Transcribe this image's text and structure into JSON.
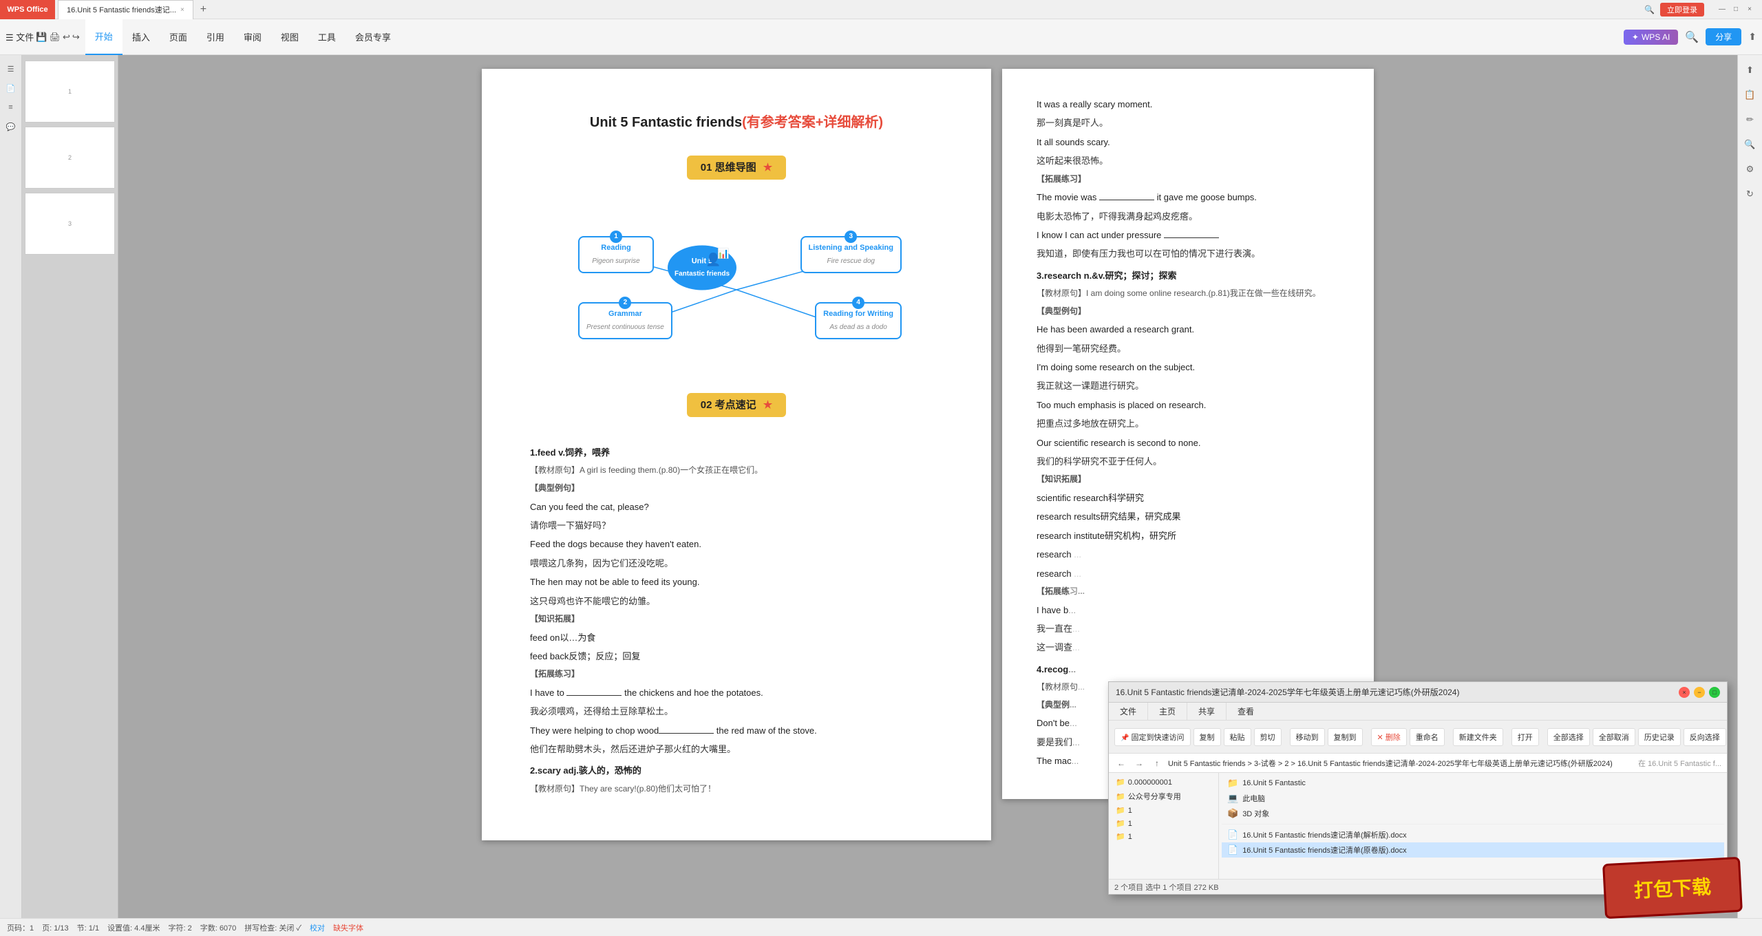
{
  "titlebar": {
    "logo": "WPS Office",
    "tab_name": "16.Unit 5 Fantastic friends速记...",
    "tab_close": "×",
    "tab_add": "+",
    "register_btn": "立即登录",
    "win_min": "—",
    "win_max": "□",
    "win_close": "×"
  },
  "ribbon": {
    "quick_items": [
      "文件",
      "▼"
    ],
    "tabs": [
      "开始",
      "插入",
      "页面",
      "引用",
      "审阅",
      "视图",
      "工具",
      "会员专享"
    ],
    "active_tab": "开始",
    "wps_ai": "WPS AI",
    "search_icon": "🔍",
    "share_btn": "分享"
  },
  "status_bar": {
    "page": "页码：1",
    "total_pages": "页: 1/13",
    "section": "节: 1/1",
    "settings": "设置值: 4.4厘米",
    "column": "字符: 2",
    "word_count": "字数: 6070",
    "spell_check": "拼写检查: 关闭 ✓",
    "proofread": "校对",
    "missing_font": "缺失字体"
  },
  "doc_left": {
    "title_black": "Unit 5 Fantastic friends",
    "title_red": "(有参考答案+详细解析)",
    "section1_label": "01  思维导图",
    "star": "★",
    "mind_center_line1": "Unit 5",
    "mind_center_line2": "Fantastic friends",
    "node1_num": "1",
    "node1_title": "Reading",
    "node1_subtitle": "Pigeon surprise",
    "node2_num": "2",
    "node2_title": "Grammar",
    "node2_subtitle": "Present continuous tense",
    "node3_num": "3",
    "node3_title": "Listening and Speaking",
    "node3_subtitle": "Fire rescue dog",
    "node4_num": "4",
    "node4_title": "Reading for Writing",
    "node4_subtitle": "As dead as a dodo",
    "section2_label": "02  考点速记",
    "star2": "★",
    "items": [
      {
        "id": "1",
        "en_word": "1.feed v.饲养，喂养",
        "note1": "【教材原句】A girl is feeding them.(p.80)一个女孩正在喂它们。",
        "note2": "【典型例句】",
        "examples": [
          {
            "en": "Can you feed the cat, please?",
            "cn": "请你喂一下猫好吗？"
          },
          {
            "en": "Feed the dogs because they haven't eaten.",
            "cn": "喂喂这几条狗，因为它们还没吃呢。"
          },
          {
            "en": "The hen may not be able to feed its young.",
            "cn": "这只母鸡也许不能喂它的幼雏。"
          }
        ],
        "expand": "【知识拓展】",
        "expand_items": [
          "feed on以…为食",
          "feed back反馈；反应；回复"
        ],
        "practice": "【拓展练习】",
        "practice_en": "I have to __________ the chickens and hoe the potatoes.",
        "practice_cn": "我必须喂鸡，还得给土豆除草松土。",
        "practice2_en": "They were helping to chop wood__________ the red maw of the stove.",
        "practice2_cn": "他们在帮助劈木头，然后还进炉子那火红的大嘴里。"
      },
      {
        "id": "2",
        "word": "2.scary adj.骇人的，恐怖的",
        "note1": "【教材原句】They are scary!(p.80)他们太可怕了！"
      }
    ]
  },
  "doc_right": {
    "lines": [
      {
        "en": "It was a really scary moment.",
        "cn": "那一刻真是吓人。"
      },
      {
        "en": "It all sounds scary.",
        "cn": "这听起来很恐怖。"
      },
      {
        "bracket": "【拓展练习】"
      },
      {
        "en": "The movie was __________ it gave me goose bumps.",
        "cn": "电影太恐怖了，吓得我满身起鸡皮疙瘩。"
      },
      {
        "en": "I know I can act under pressure __________",
        "cn": "我知道，即使有压力我也可以在可怕的情况下进行表演。"
      },
      {
        "word": "3.research n.&v.研究；探讨；探索"
      },
      {
        "bracket": "【教材原句】I am doing some online research.(p.81)我正在做一些在线研究。"
      },
      {
        "bracket": "【典型例句】"
      },
      {
        "en": "He has been awarded a research grant.",
        "cn": "他得到一笔研究经费。"
      },
      {
        "en": "I'm doing some research on the subject.",
        "cn": "我正就这一课题进行研究。"
      },
      {
        "en": "Too much emphasis is placed on research.",
        "cn": "把重点过多地放在研究上。"
      },
      {
        "en": "Our scientific research is second to none.",
        "cn": "我们的科学研究不亚于任何人。"
      },
      {
        "bracket": "【知识拓展】"
      },
      {
        "item": "scientific research科学研究"
      },
      {
        "item": "research results研究结果，研究成果"
      },
      {
        "item": "research institute研究机构，研究所"
      },
      {
        "item": "research..."
      },
      {
        "item": "research..."
      },
      {
        "bracket2": "【拓展练习..."
      },
      {
        "en2": "I have b...",
        "cn2": "我一直在..."
      },
      {
        "cn3": "这一调查..."
      },
      {
        "word2": "4.recog..."
      },
      {
        "bracket3": "【教材原句..."
      },
      {
        "bracket4": "【典型例..."
      },
      {
        "en3": "Don't be...",
        "cn4": "要是我们..."
      },
      {
        "en4": "The mac...",
        "cn5": ""
      }
    ]
  },
  "file_manager": {
    "title": "16.Unit 5 Fantastic friends速记清单-2024-2025学年七年级英语上册单元速记巧练(外研版2024)",
    "toolbar_buttons": [
      "固定到快速访问",
      "复制",
      "粘贴",
      "剪切",
      "移动到",
      "复制到",
      "删除",
      "重命名",
      "新建文件夹",
      "打开",
      "全部选择",
      "全部取消",
      "历史记录",
      "反向选择"
    ],
    "nav_path": "< > ↑  Unit 5 Fantastic friends > 3-试卷 > 2 > 16.Unit 5 Fantastic friends速记清单-2024-2025学年七年级英语上册单元速记巧练(外研版2024)",
    "nav_search": "在 16.Unit 5 Fantastic f...",
    "left_items": [
      {
        "name": "0.000000001",
        "type": "folder"
      },
      {
        "name": "公众号分享专用",
        "type": "folder"
      },
      {
        "name": "1",
        "type": "folder"
      },
      {
        "name": "1",
        "type": "folder"
      },
      {
        "name": "1",
        "type": "folder"
      }
    ],
    "right_files": [
      {
        "name": "16.Unit 5 Fantastic",
        "type": "folder"
      },
      {
        "name": "此电脑",
        "type": "system"
      },
      {
        "name": "3D 对象",
        "type": "folder"
      },
      {
        "name": "...",
        "type": "folder"
      }
    ],
    "selected_files": [
      {
        "name": "16.Unit 5 Fantastic friends速记清单(解析版).docx",
        "icon": "📄"
      },
      {
        "name": "16.Unit 5 Fantastic friends速记清单(原卷版).docx",
        "icon": "📄",
        "selected": true
      }
    ],
    "status": "2 个项目  选中 1 个项目  272 KB"
  },
  "download_banner": {
    "text": "打包下载"
  }
}
